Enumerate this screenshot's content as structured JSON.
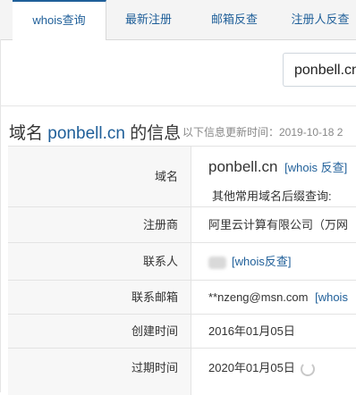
{
  "tabs": [
    {
      "label": "whois查询",
      "active": true
    },
    {
      "label": "最新注册",
      "active": false
    },
    {
      "label": "邮箱反查",
      "active": false
    },
    {
      "label": "注册人反查",
      "active": false
    }
  ],
  "search": {
    "value": "ponbell.cn"
  },
  "header": {
    "prefix": "域名",
    "domain": "ponbell.cn",
    "suffix": "的信息",
    "updated": "以下信息更新时间：2019-10-18 2"
  },
  "rows": [
    {
      "label": "域名",
      "value": "ponbell.cn",
      "link": "[whois 反查]",
      "subtext": "其他常用域名后缀查询:"
    },
    {
      "label": "注册商",
      "value": "阿里云计算有限公司（万网"
    },
    {
      "label": "联系人",
      "value": "",
      "link": "[whois反查]"
    },
    {
      "label": "联系邮箱",
      "value": "**nzeng@msn.com",
      "link": "[whois"
    },
    {
      "label": "创建时间",
      "value": "2016年01月05日"
    },
    {
      "label": "过期时间",
      "value": "2020年01月05日"
    }
  ],
  "colors": {
    "accent": "#1f5f99",
    "label_bg": "#f7f7f7"
  }
}
